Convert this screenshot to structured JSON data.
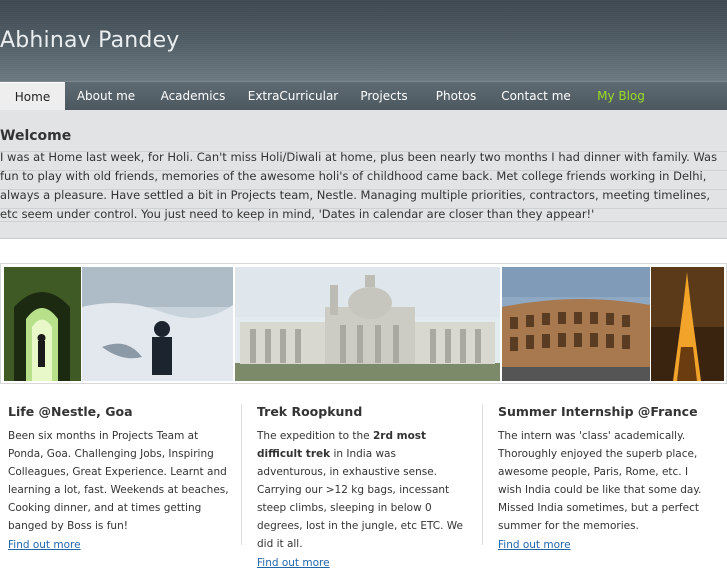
{
  "site": {
    "title": "Abhinav Pandey"
  },
  "nav": {
    "items": [
      {
        "label": "Home"
      },
      {
        "label": "About me"
      },
      {
        "label": "Academics"
      },
      {
        "label": "ExtraCurricular"
      },
      {
        "label": "Projects"
      },
      {
        "label": "Photos"
      },
      {
        "label": "Contact me"
      },
      {
        "label": "My Blog"
      }
    ],
    "blog_color": "#99dd22"
  },
  "welcome": {
    "heading": "Welcome",
    "text": "I was at Home last week, for Holi. Can't miss Holi/Diwali at home, plus been nearly two months I had dinner with family. Was fun to play with old friends, memories of the awesome holi's of childhood came back. Met college friends working in Delhi, always a pleasure. Have settled a bit in Projects team, Nestle. Managing multiple priorities, contractors, meeting timelines, etc seem under control. You just need to keep in mind, 'Dates in calendar are closer than they appear!'"
  },
  "columns": [
    {
      "title": "Life @Nestle, Goa",
      "text": "Been six months in Projects Team at Ponda, Goa. Challenging Jobs, Inspiring Colleagues, Great Experience. Learnt and learning a lot, fast. Weekends at beaches, Cooking dinner, and at times getting banged by Boss is fun!",
      "link": "Find out more"
    },
    {
      "title": "Trek Roopkund",
      "text_before": "The expedition to the ",
      "text_bold": "2rd most difficult trek",
      "text_after": " in India was adventurous, in exhaustive sense. Carrying our >12 kg bags, incessant steep climbs, sleeping in below 0 degrees, lost in the jungle, etc ETC. We did it all.",
      "link": "Find out more"
    },
    {
      "title": "Summer Internship @France",
      "text": "The intern was 'class' academically. Thoroughly enjoyed the superb place, awesome people, Paris, Rome, etc. I wish India could be like that some day. Missed India sometimes, but a perfect summer for the memories.",
      "link": "Find out more"
    }
  ],
  "colors": {
    "link": "#2266aa",
    "header": "#4d5961"
  }
}
